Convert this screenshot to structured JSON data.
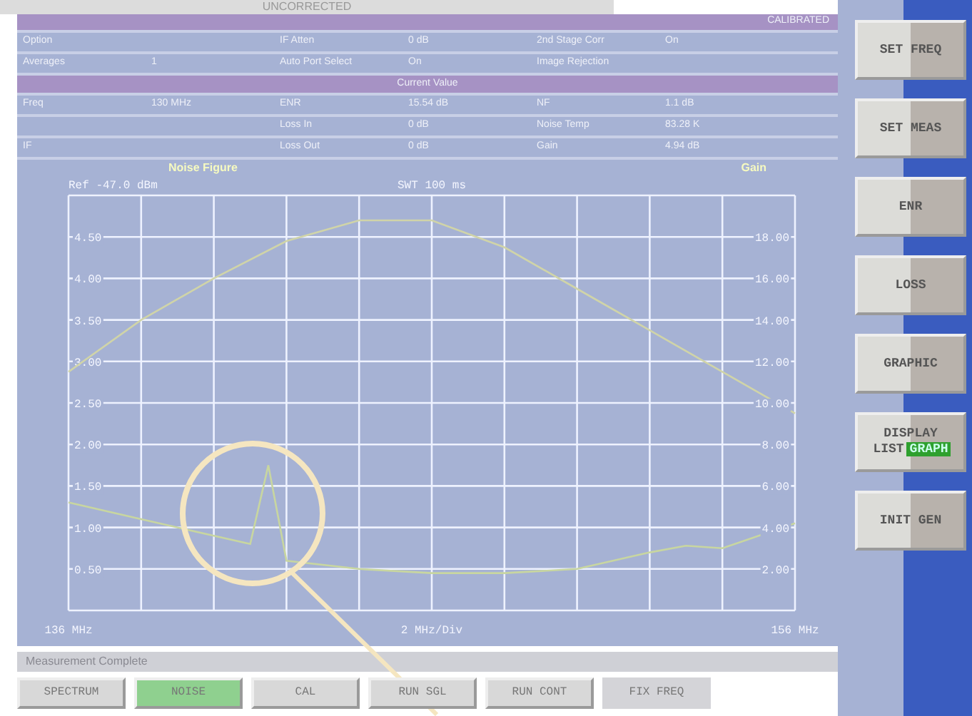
{
  "title_bar": {
    "title": "UNCORRECTED"
  },
  "info_table": {
    "status": "CALIBRATED",
    "rows": [
      [
        "Option",
        "",
        "IF Atten",
        "0 dB",
        "2nd Stage Corr",
        "On"
      ],
      [
        "Averages",
        "1",
        "Auto Port Select",
        "On",
        "Image Rejection",
        ""
      ]
    ],
    "section": "Current Value",
    "value_rows": [
      [
        "Freq",
        "130 MHz",
        "ENR",
        "15.54 dB",
        "NF",
        "1.1 dB"
      ],
      [
        "",
        "",
        "Loss In",
        "0 dB",
        "Noise Temp",
        "83.28 K"
      ],
      [
        "IF",
        "",
        "Loss Out",
        "0 dB",
        "Gain",
        "4.94 dB"
      ]
    ]
  },
  "graph": {
    "ref": "Ref -47.0 dBm",
    "sweep": "SWT 100 ms",
    "span": "2 MHz/Div",
    "chart_data": {
      "type": "line",
      "grid": true,
      "x": [
        136,
        138,
        140,
        141,
        141.5,
        142,
        144,
        146,
        148,
        150,
        152,
        153,
        154,
        156
      ],
      "xlim": [
        136,
        156
      ],
      "xticks": [
        {
          "value": 136,
          "label": "136 MHz"
        },
        {
          "value": 156,
          "label": "156 MHz"
        }
      ],
      "ylim": [
        0,
        5
      ],
      "yticks": [
        {
          "value": 4.5,
          "label": "4.50"
        },
        {
          "value": 4,
          "label": "4.00"
        },
        {
          "value": 3.5,
          "label": "3.50"
        },
        {
          "value": 3,
          "label": "3.00"
        },
        {
          "value": 2.5,
          "label": "2.50"
        },
        {
          "value": 2,
          "label": "2.00"
        },
        {
          "value": 1.5,
          "label": "1.50"
        },
        {
          "value": 1,
          "label": "1.00"
        },
        {
          "value": 0.5,
          "label": "0.50"
        }
      ],
      "series": [
        {
          "name": "Noise Figure",
          "color": "#c8d6a0",
          "values": [
            1.3,
            1.1,
            0.9,
            0.8,
            1.75,
            0.6,
            0.5,
            0.45,
            0.45,
            0.5,
            0.7,
            0.78,
            0.75,
            1.05
          ]
        }
      ]
    }
  },
  "gain_graph": {
    "chart_data": {
      "type": "line",
      "grid": false,
      "x": [
        136,
        138,
        140,
        142,
        144,
        146,
        148,
        150,
        152,
        154,
        156
      ],
      "xlim": [
        136,
        156
      ],
      "ylim": [
        0,
        20
      ],
      "yticks": [
        {
          "value": 18,
          "label": "18.00"
        },
        {
          "value": 16,
          "label": "16.00"
        },
        {
          "value": 14,
          "label": "14.00"
        },
        {
          "value": 12,
          "label": "12.00"
        },
        {
          "value": 10,
          "label": "10.00"
        },
        {
          "value": 8,
          "label": "8.00"
        },
        {
          "value": 6,
          "label": "6.00"
        },
        {
          "value": 4,
          "label": "4.00"
        },
        {
          "value": 2,
          "label": "2.00"
        }
      ],
      "series": [
        {
          "name": "Gain",
          "color": "#d0d4a8",
          "values": [
            11.5,
            14,
            16,
            17.8,
            18.8,
            18.8,
            17.5,
            15.5,
            13.5,
            11.5,
            9.5
          ]
        }
      ]
    }
  },
  "status_bar": {
    "message": "Measurement Complete"
  },
  "bottom_buttons": [
    {
      "label": "SPECTRUM",
      "selected": false,
      "disabled": false
    },
    {
      "label": "NOISE",
      "selected": true,
      "disabled": false
    },
    {
      "label": "CAL",
      "selected": false,
      "disabled": false
    },
    {
      "label": "RUN SGL",
      "selected": false,
      "disabled": false
    },
    {
      "label": "RUN CONT",
      "selected": false,
      "disabled": false
    },
    {
      "label": "FIX FREQ",
      "selected": false,
      "disabled": true
    }
  ],
  "side_buttons": [
    {
      "kind": "plain",
      "label": "SET FREQ"
    },
    {
      "kind": "plain",
      "label": "SET MEAS"
    },
    {
      "kind": "plain",
      "label": "ENR"
    },
    {
      "kind": "plain",
      "label": "LOSS"
    },
    {
      "kind": "plain",
      "label": "GRAPHIC"
    },
    {
      "kind": "toggle",
      "label": "DISPLAY",
      "options": [
        {
          "label": "LIST",
          "selected": false
        },
        {
          "label": "GRAPH",
          "selected": true
        }
      ]
    },
    {
      "kind": "plain",
      "label": "INIT GEN"
    }
  ]
}
